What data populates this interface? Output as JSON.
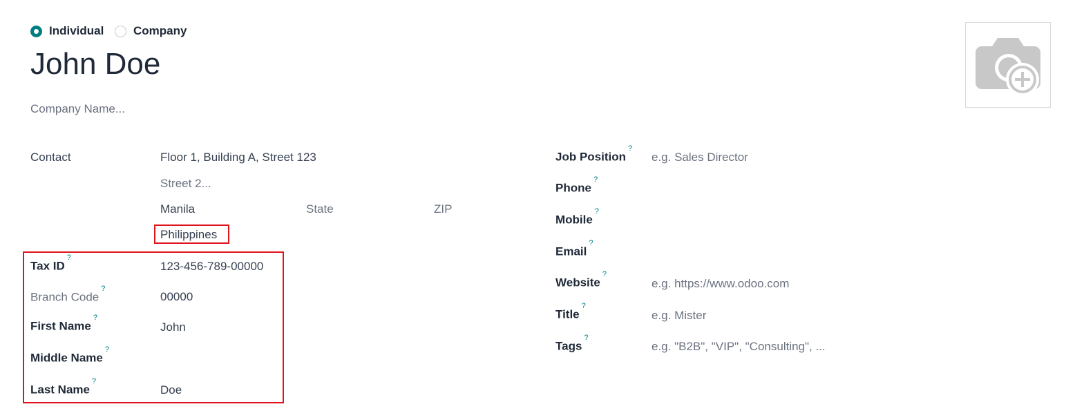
{
  "partner_type": {
    "individual_label": "Individual",
    "company_label": "Company",
    "selected": "Individual"
  },
  "name": "John Doe",
  "company_name_placeholder": "Company Name...",
  "address": {
    "label": "Contact",
    "street": "Floor 1, Building A, Street 123",
    "street2_placeholder": "Street 2...",
    "city": "Manila",
    "state_placeholder": "State",
    "zip_placeholder": "ZIP",
    "country": "Philippines"
  },
  "left_fields": {
    "tax_id": {
      "label": "Tax ID",
      "value": "123-456-789-00000"
    },
    "branch_code": {
      "label": "Branch Code",
      "value": "00000"
    },
    "first_name": {
      "label": "First Name",
      "value": "John"
    },
    "middle_name": {
      "label": "Middle Name",
      "value": ""
    },
    "last_name": {
      "label": "Last Name",
      "value": "Doe"
    }
  },
  "right_fields": {
    "job_position": {
      "label": "Job Position",
      "placeholder": "e.g. Sales Director"
    },
    "phone": {
      "label": "Phone",
      "placeholder": ""
    },
    "mobile": {
      "label": "Mobile",
      "placeholder": ""
    },
    "email": {
      "label": "Email",
      "placeholder": ""
    },
    "website": {
      "label": "Website",
      "placeholder": "e.g. https://www.odoo.com"
    },
    "title": {
      "label": "Title",
      "placeholder": "e.g. Mister"
    },
    "tags": {
      "label": "Tags",
      "placeholder": "e.g. \"B2B\", \"VIP\", \"Consulting\", ..."
    }
  },
  "help_mark": "?",
  "icons": {
    "avatar": "camera-plus-icon"
  },
  "colors": {
    "accent": "#017e84",
    "highlight": "#e0131d"
  }
}
